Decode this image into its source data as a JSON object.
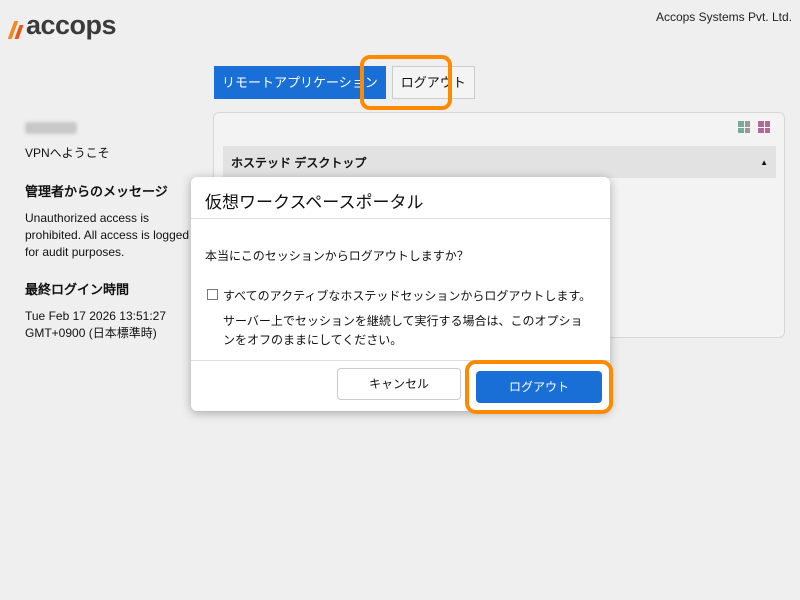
{
  "brand": {
    "logo_text": "accops",
    "company": "Accops Systems Pvt. Ltd."
  },
  "sidebar": {
    "welcome": "VPNへようこそ",
    "message_title": "管理者からのメッセージ",
    "message_body": "Unauthorized access is prohibited. All access is logged for audit purposes.",
    "login_title": "最終ログイン時間",
    "login_time": "Tue Feb 17 2026 13:51:27 GMT+0900 (日本標準時)"
  },
  "tabs": {
    "remote_apps": "リモートアプリケーション",
    "logout": "ログアウト"
  },
  "panel": {
    "group_header": "ホステッド デスクトップ",
    "caret": "▲",
    "view_icons": [
      "list-view-icon",
      "grid-view-icon"
    ]
  },
  "dialog": {
    "title": "仮想ワークスペースポータル",
    "question": "本当にこのセッションからログアウトしますか？",
    "option_label": "すべてのアクティブなホステッドセッションからログアウトします。",
    "option_checked": false,
    "option_note": "サーバー上でセッションを継続して実行する場合は、このオプションをオフのままにしてください。",
    "cancel_label": "キャンセル",
    "logout_label": "ログアウト"
  },
  "colors": {
    "accent": "#1a6fd6",
    "highlight": "#ff8a00",
    "logo_orange": "#f08a24"
  }
}
